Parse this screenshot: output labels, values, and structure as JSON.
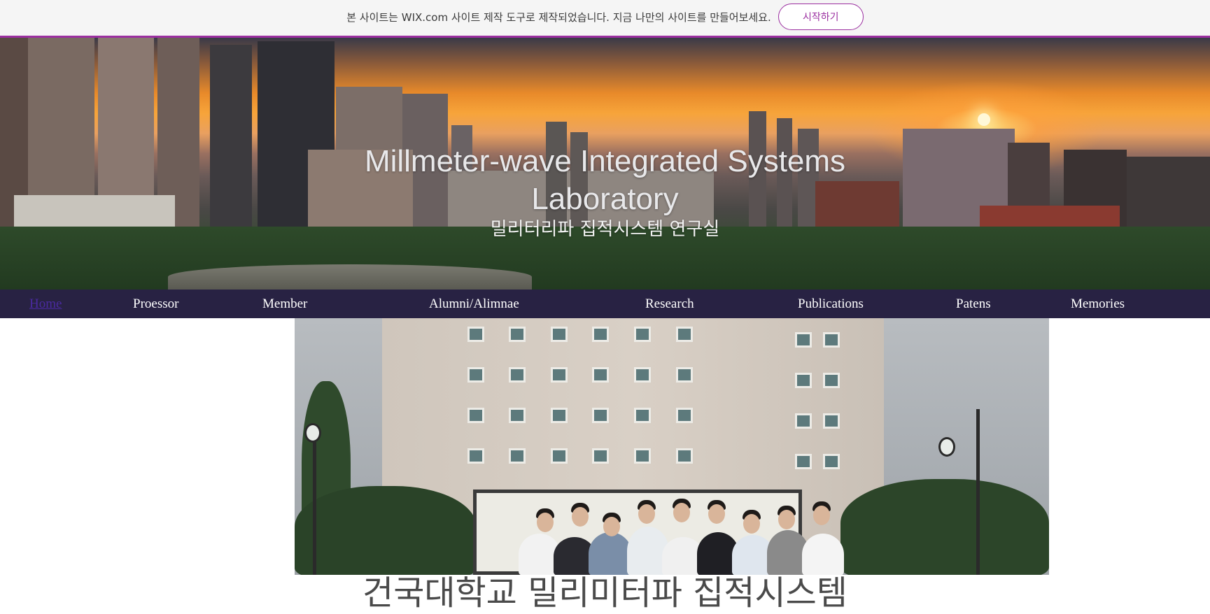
{
  "wix_banner": {
    "message": "본 사이트는 WIX.com 사이트 제작 도구로 제작되었습니다. 지금 나만의 사이트를 만들어보세요.",
    "button_label": "시작하기",
    "accent_color": "#9b2fa0"
  },
  "hero": {
    "title_line1": "Millmeter-wave Integrated Systems",
    "title_line2": "Laboratory",
    "subtitle": "밀리터리파 집적시스템 연구실"
  },
  "nav": {
    "background": "#282243",
    "items": [
      {
        "label": "Home",
        "active": true
      },
      {
        "label": "Proessor"
      },
      {
        "label": "Member"
      },
      {
        "label": "Alumni/Alimnae"
      },
      {
        "label": "Research"
      },
      {
        "label": "Publications"
      },
      {
        "label": "Patens"
      },
      {
        "label": "Memories"
      }
    ]
  },
  "main": {
    "photo_icon": "group-photo",
    "heading": "건국대학교 밀리미터파 집적시스템"
  }
}
